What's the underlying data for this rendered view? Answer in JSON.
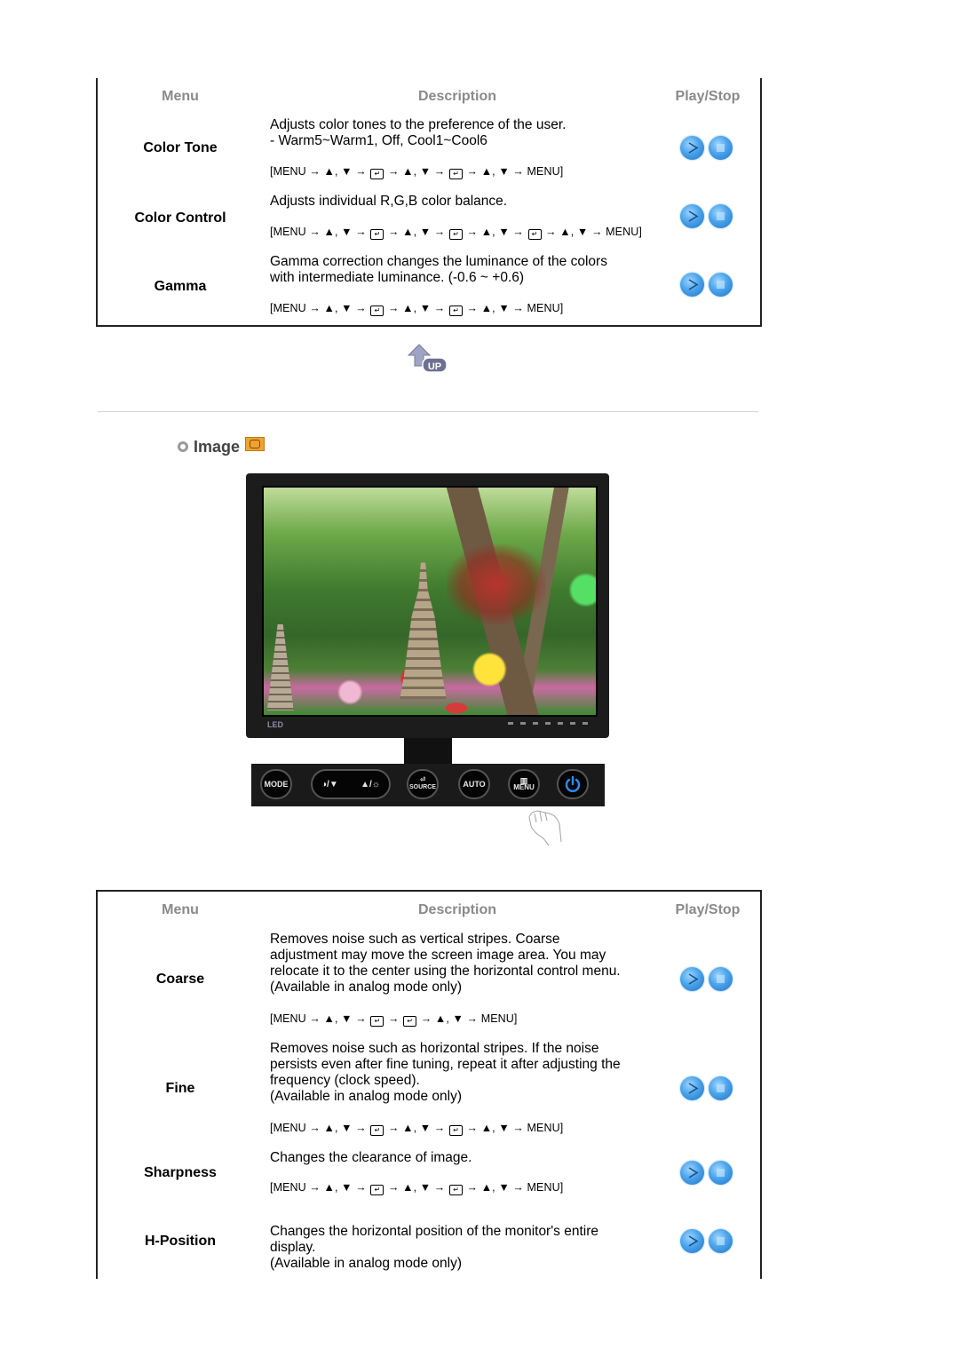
{
  "table1": {
    "headers": {
      "menu": "Menu",
      "description": "Description",
      "playstop": "Play/Stop"
    },
    "rows": [
      {
        "menu": "Color Tone",
        "description": "Adjusts color tones to the preference of the user.\n- Warm5~Warm1, Off, Cool1~Cool6",
        "path": [
          "[MENU",
          "→ ▲, ▼ →",
          "enter",
          "→ ▲, ▼ →",
          "enter",
          "→ ▲, ▼ → MENU]"
        ]
      },
      {
        "menu": "Color Control",
        "description": "Adjusts individual R,G,B color balance.",
        "path": [
          "[MENU",
          "→ ▲, ▼ →",
          "enter",
          "→ ▲, ▼ →",
          "enter",
          "→ ▲, ▼ →",
          "enter",
          "→ ▲, ▼ → MENU]"
        ]
      },
      {
        "menu": "Gamma",
        "description": "Gamma correction changes the luminance of the colors\nwith intermediate luminance. (-0.6 ~ +0.6)",
        "path": [
          "[MENU",
          "→ ▲, ▼ →",
          "enter",
          "→ ▲, ▼ →",
          "enter",
          "→ ▲, ▼ → MENU]"
        ]
      }
    ]
  },
  "up_link": {
    "label": "UP",
    "icon": "up-arrow-icon"
  },
  "section": {
    "title": "Image",
    "bullet_icon": "circle-bullet-icon",
    "badge_icon": "image-mode-icon"
  },
  "monitor": {
    "brand_label": "LED",
    "control_buttons": [
      {
        "id": "mode",
        "label": "MODE"
      },
      {
        "id": "brightness",
        "label_left": "◑/▼",
        "label_right": "▲/☼"
      },
      {
        "id": "source",
        "label": "SOURCE",
        "icon": "enter-icon"
      },
      {
        "id": "auto",
        "label": "AUTO"
      },
      {
        "id": "menu",
        "label": "MENU",
        "icon": "menu-grid-icon"
      },
      {
        "id": "power",
        "icon": "power-icon",
        "color": "#2f8cff"
      }
    ]
  },
  "table2": {
    "headers": {
      "menu": "Menu",
      "description": "Description",
      "playstop": "Play/Stop"
    },
    "rows": [
      {
        "menu": "Coarse",
        "description": "Removes noise such as vertical stripes. Coarse\nadjustment may move the screen image area. You may\nrelocate it to the center using the horizontal control menu.\n(Available in analog mode only)",
        "path": [
          "[MENU",
          "→ ▲, ▼ →",
          "enter",
          "→",
          "enter",
          "→ ▲, ▼ → MENU]"
        ]
      },
      {
        "menu": "Fine",
        "description": "Removes noise such as horizontal stripes. If the noise\npersists even after fine tuning, repeat it after adjusting the\nfrequency (clock speed).\n(Available in analog mode only)",
        "path": [
          "[MENU",
          "→ ▲, ▼ →",
          "enter",
          "→ ▲, ▼ →",
          "enter",
          "→ ▲, ▼ → MENU]"
        ]
      },
      {
        "menu": "Sharpness",
        "description": "Changes the clearance of image.",
        "path": [
          "[MENU",
          "→ ▲, ▼ →",
          "enter",
          "→ ▲, ▼ →",
          "enter",
          "→ ▲, ▼ → MENU]"
        ]
      },
      {
        "menu": "H-Position",
        "description": "Changes the horizontal position of the monitor's entire\ndisplay.\n(Available in analog mode only)"
      }
    ]
  },
  "colors": {
    "header_gray": "#8a8a8a",
    "play_blue": "#2f86d8",
    "section_icon": "#f0a230"
  }
}
